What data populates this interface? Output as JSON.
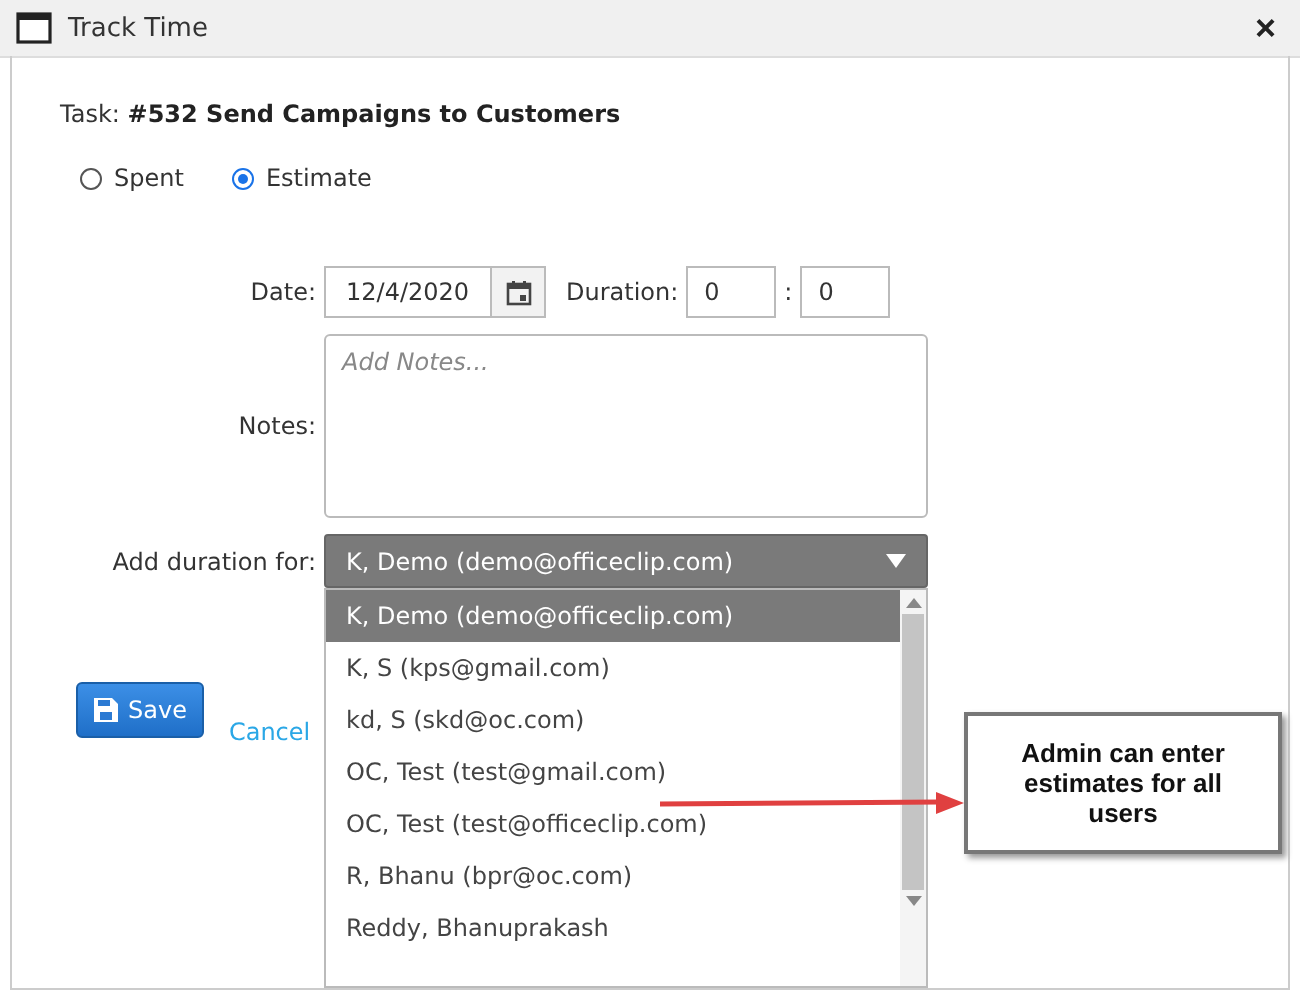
{
  "window": {
    "title": "Track Time",
    "close": "×"
  },
  "task": {
    "label": "Task:",
    "value": "#532 Send Campaigns to Customers"
  },
  "mode": [
    {
      "label": "Spent",
      "selected": false
    },
    {
      "label": "Estimate",
      "selected": true
    }
  ],
  "date": {
    "label": "Date:",
    "value": "12/4/2020"
  },
  "duration": {
    "label": "Duration:",
    "hours": "0",
    "separator": ":",
    "minutes": "0"
  },
  "notes": {
    "label": "Notes:",
    "placeholder": "Add Notes..."
  },
  "add_duration_for": {
    "label": "Add duration for:",
    "value": "K, Demo (demo@officeclip.com)",
    "expanded": true,
    "options": [
      {
        "label": "K, Demo (demo@officeclip.com)",
        "selected": true
      },
      {
        "label": "K, S (kps@gmail.com)",
        "selected": false
      },
      {
        "label": "kd, S (skd@oc.com)",
        "selected": false
      },
      {
        "label": "OC, Test (test@gmail.com)",
        "selected": false
      },
      {
        "label": "OC, Test (test@officeclip.com)",
        "selected": false
      },
      {
        "label": "R, Bhanu (bpr@oc.com)",
        "selected": false
      },
      {
        "label": "Reddy, Bhanuprakash",
        "selected": false
      }
    ]
  },
  "buttons": {
    "save": "Save",
    "cancel": "Cancel"
  },
  "callout": {
    "text": "Admin can enter estimates for all users"
  }
}
